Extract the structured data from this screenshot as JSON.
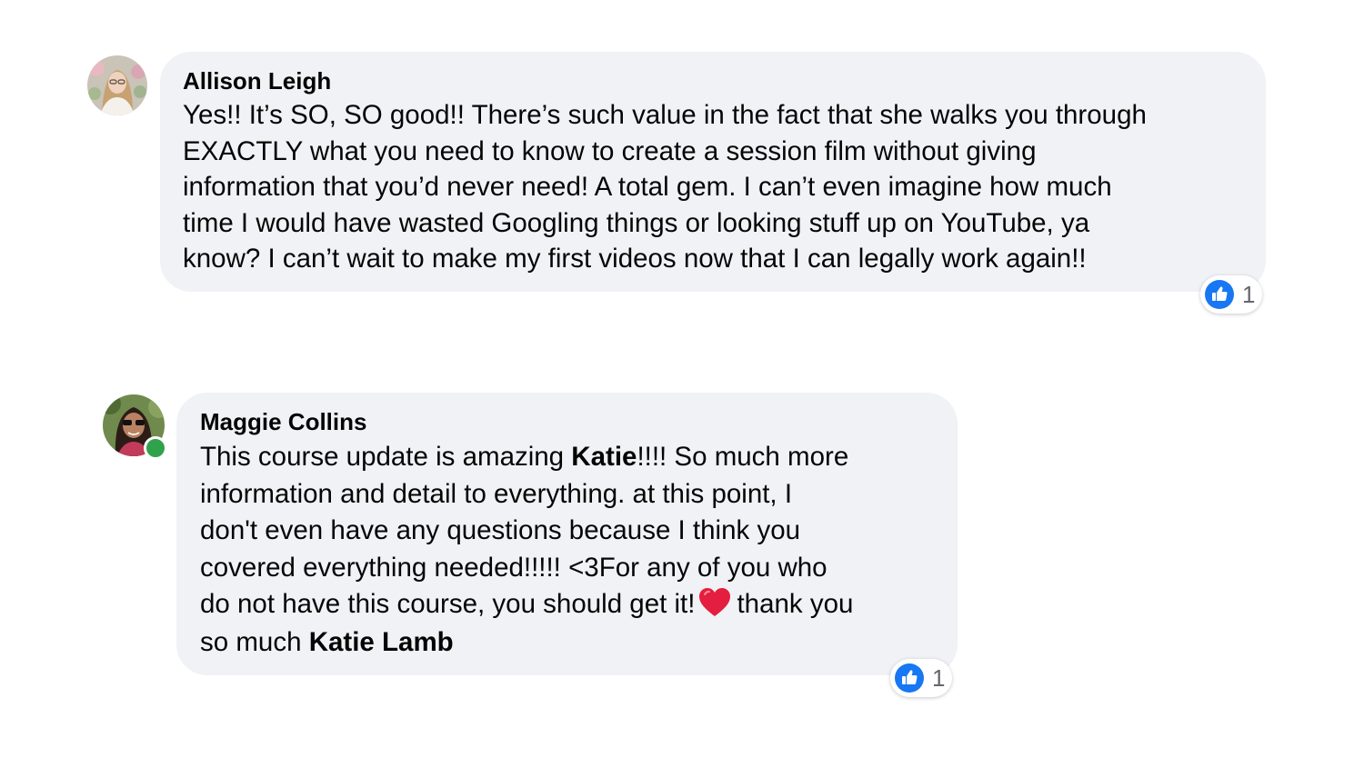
{
  "colors": {
    "bubble_bg": "#f0f2f5",
    "like_blue": "#1877f2",
    "online_green": "#31a24c",
    "heart_red": "#e41e3f"
  },
  "comments": [
    {
      "author": "Allison Leigh",
      "avatar_icon": "profile-photo",
      "online": false,
      "lines": [
        "Yes!! It’s SO, SO good!! There’s such value in the fact that she walks you through",
        "EXACTLY what you need to know to create a session film without giving",
        "information that you’d never need! A total gem. I can’t even imagine how much",
        "time I would have wasted Googling things or looking stuff up on YouTube, ya",
        "know? I can’t wait to make my first videos now that I can legally work again!!"
      ],
      "reaction_icon": "like-icon",
      "reaction_count": "1"
    },
    {
      "author": "Maggie Collins",
      "avatar_icon": "profile-photo",
      "online": true,
      "line1_pre": "This course update is amazing ",
      "line1_mention": "Katie",
      "line1_post": "!!!! So much more",
      "line2": "information and detail to everything. at this point, I",
      "line3": "don't even have any questions because I think you",
      "line4": "covered everything needed!!!!! <3For any of you who",
      "line5_pre": "do not have this course, you should get it!",
      "line5_emoji": "heart-emoji",
      "line5_post": "thank you",
      "line6_pre": "so much ",
      "line6_mention": "Katie Lamb",
      "reaction_icon": "like-icon",
      "reaction_count": "1"
    }
  ]
}
